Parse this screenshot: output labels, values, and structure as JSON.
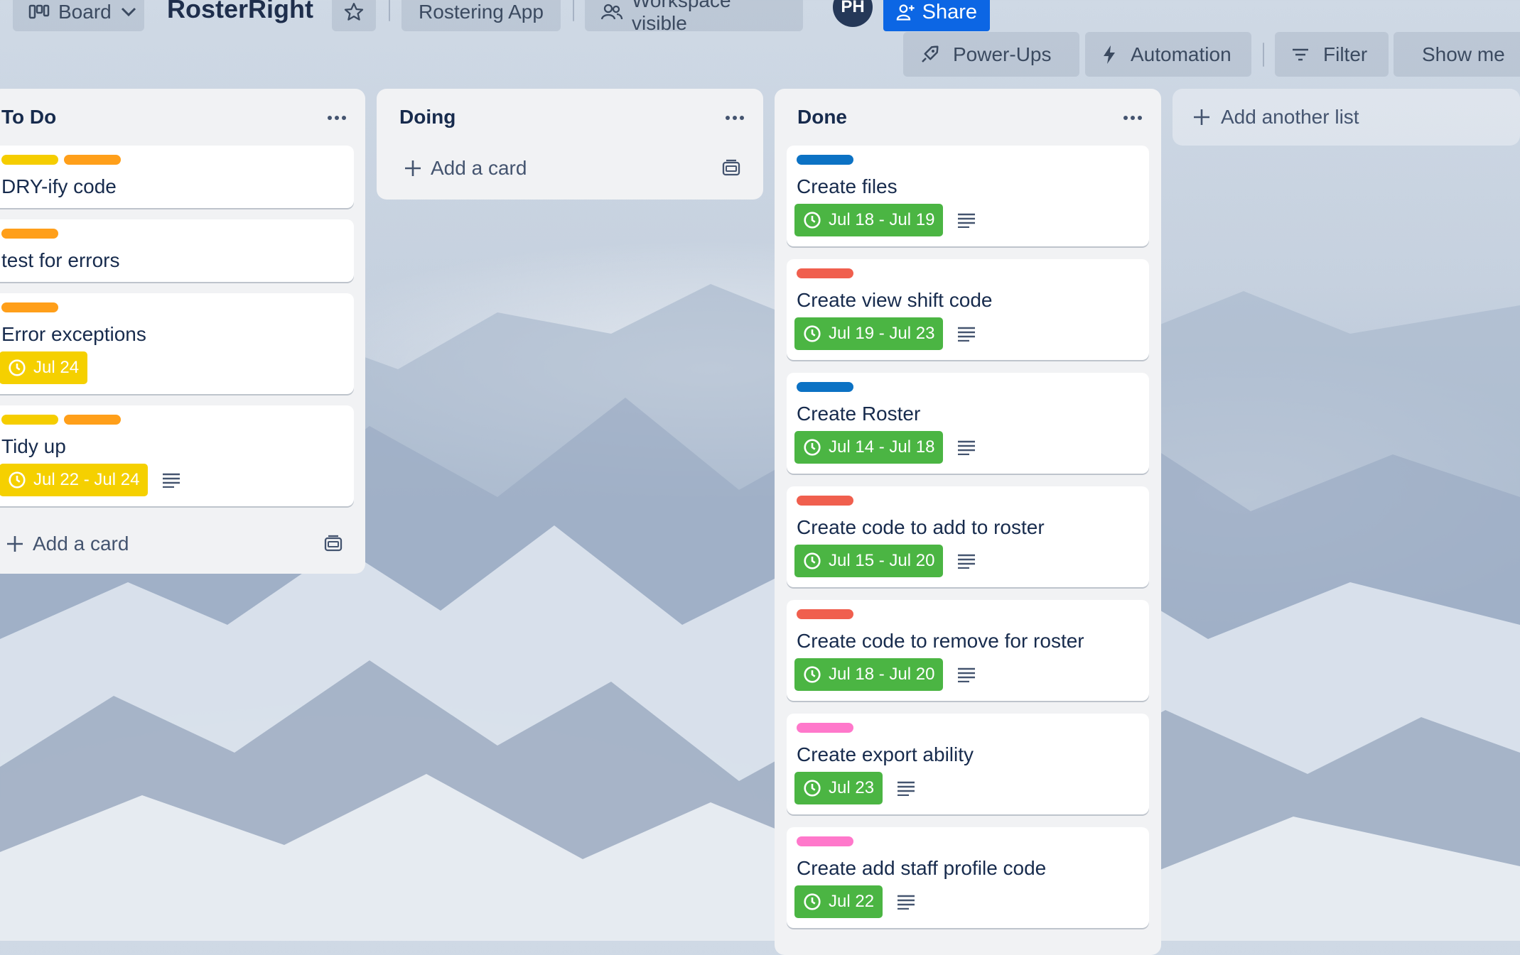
{
  "header": {
    "view_switcher": {
      "label": "Board",
      "icon": "board-icon"
    },
    "board_title": "RosterRight",
    "star_icon": "star-icon",
    "workspace_name": "Rostering App",
    "visibility": {
      "label": "Workspace visible",
      "icon": "people-icon"
    },
    "avatar_initials": "PH",
    "share": {
      "label": "Share",
      "icon": "add-person-icon"
    },
    "power_ups": {
      "label": "Power-Ups",
      "icon": "rocket-icon"
    },
    "automation": {
      "label": "Automation",
      "icon": "lightning-icon"
    },
    "filter": {
      "label": "Filter",
      "icon": "filter-icon"
    },
    "show_menu": {
      "label": "Show me"
    }
  },
  "label_colors": {
    "yellow": "#f5cd00",
    "orange": "#ff9f1a",
    "blue": "#0c72c4",
    "red": "#f05f4e",
    "pink": "#ff78cb"
  },
  "lists": [
    {
      "title": "To Do",
      "add_card_label": "Add a card",
      "cards": [
        {
          "title": "DRY-ify code",
          "labels": [
            "yellow",
            "orange"
          ]
        },
        {
          "title": "test for errors",
          "labels": [
            "orange"
          ]
        },
        {
          "title": "Error exceptions",
          "labels": [
            "orange"
          ],
          "date": "Jul 24",
          "date_status": "due-soon"
        },
        {
          "title": "Tidy up",
          "labels": [
            "yellow",
            "orange"
          ],
          "date": "Jul 22 - Jul 24",
          "date_status": "due-soon",
          "has_description": true
        }
      ]
    },
    {
      "title": "Doing",
      "add_card_label": "Add a card",
      "cards": []
    },
    {
      "title": "Done",
      "add_card_label": "Add a card",
      "cards": [
        {
          "title": "Create files",
          "labels": [
            "blue"
          ],
          "date": "Jul 18 - Jul 19",
          "date_status": "complete",
          "has_description": true
        },
        {
          "title": "Create view shift code",
          "labels": [
            "red"
          ],
          "date": "Jul 19 - Jul 23",
          "date_status": "complete",
          "has_description": true
        },
        {
          "title": "Create Roster",
          "labels": [
            "blue"
          ],
          "date": "Jul 14 - Jul 18",
          "date_status": "complete",
          "has_description": true
        },
        {
          "title": "Create code to add to roster",
          "labels": [
            "red"
          ],
          "date": "Jul 15 - Jul 20",
          "date_status": "complete",
          "has_description": true
        },
        {
          "title": "Create code to remove for roster",
          "labels": [
            "red"
          ],
          "date": "Jul 18 - Jul 20",
          "date_status": "complete",
          "has_description": true
        },
        {
          "title": "Create export ability",
          "labels": [
            "pink"
          ],
          "date": "Jul 23",
          "date_status": "complete",
          "has_description": true
        },
        {
          "title": "Create add staff profile code",
          "labels": [
            "pink"
          ],
          "date": "Jul 22",
          "date_status": "complete",
          "has_description": true
        }
      ]
    }
  ],
  "add_list_label": "Add another list"
}
